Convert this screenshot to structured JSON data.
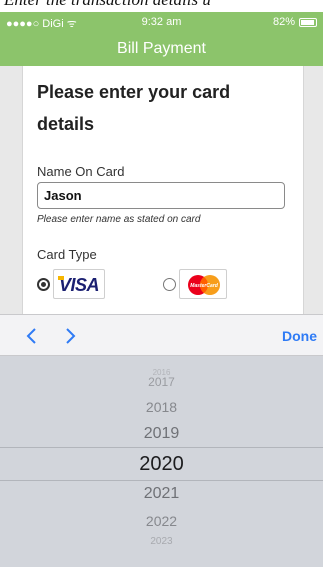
{
  "caption": {
    "text": "Enter the transaction details u"
  },
  "status_bar": {
    "carrier": "●●●●○ DiGi ᯤ",
    "time": "9:32 am",
    "battery": "82%"
  },
  "nav_bar": {
    "title": "Bill Payment"
  },
  "form": {
    "heading": "Please enter your card details",
    "name_label": "Name On Card",
    "name_value": "Jason",
    "name_hint": "Please enter name as stated on card",
    "card_type_label": "Card Type",
    "visa_logo_text": "VISA",
    "mastercard_logo_text": "MasterCard",
    "selected_card": "VISA"
  },
  "picker_toolbar": {
    "done_label": "Done"
  },
  "year_picker": {
    "items": [
      "2016",
      "2017",
      "2018",
      "2019",
      "2020",
      "2021",
      "2022",
      "2023"
    ],
    "selected": "2020"
  },
  "colors": {
    "brand_green": "#8cc46b",
    "ios_blue": "#2f7bf5",
    "picker_bg": "#d2d5db"
  }
}
